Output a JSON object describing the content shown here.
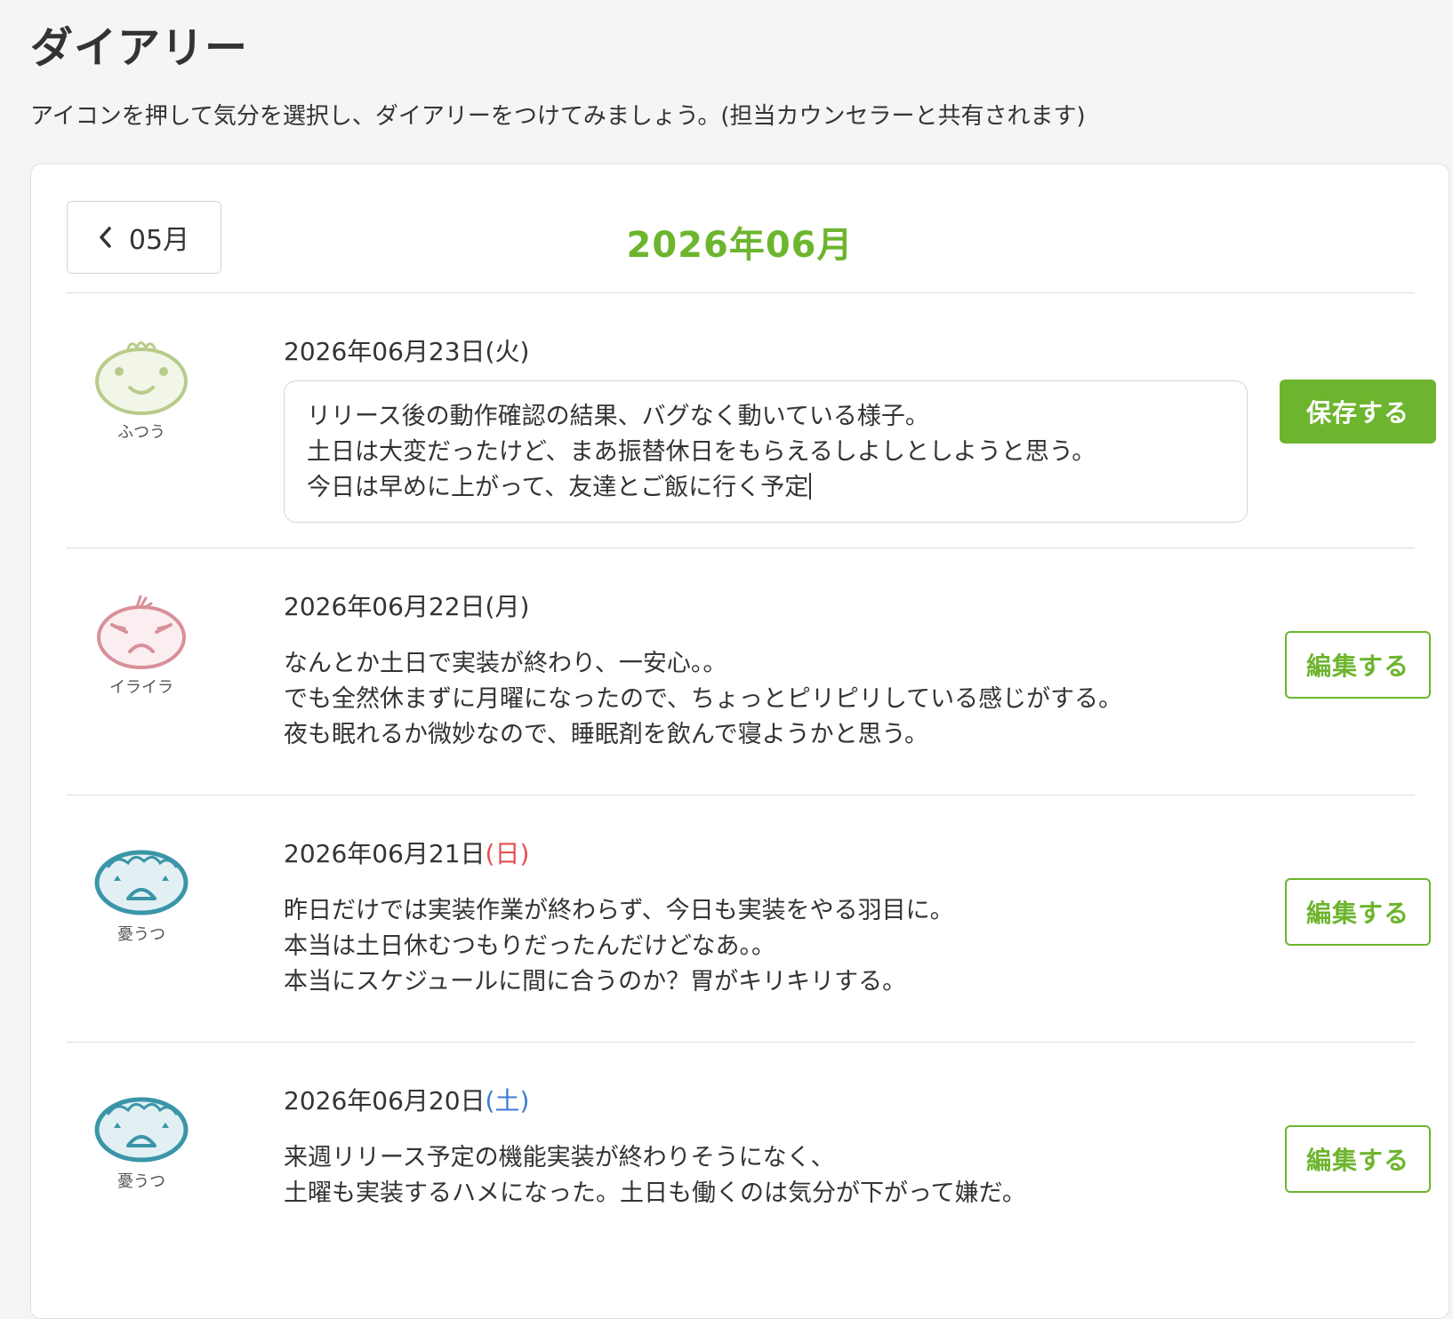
{
  "header": {
    "title": "ダイアリー",
    "description": "アイコンを押して気分を選択し、ダイアリーをつけてみましょう。(担当カウンセラーと共有されます)"
  },
  "nav": {
    "prev_month_label": "05月",
    "current_month": "2026年06月"
  },
  "colors": {
    "accent": "#6db52e",
    "sunday": "#e35050",
    "saturday": "#3a7bd5",
    "mood_normal": "#b8cc8a",
    "mood_irritated": "#d8909a",
    "mood_depressed": "#3b95a8"
  },
  "entries": [
    {
      "date": "2026年06月23日",
      "weekday": "(火)",
      "weekday_type": "weekday",
      "mood": "ふつう",
      "mood_icon": "normal-face-icon",
      "editing": true,
      "text": "リリース後の動作確認の結果、バグなく動いている様子。\n土日は大変だったけど、まあ振替休日をもらえるしよしとしようと思う。\n今日は早めに上がって、友達とご飯に行く予定",
      "action_label": "保存する"
    },
    {
      "date": "2026年06月22日",
      "weekday": "(月)",
      "weekday_type": "weekday",
      "mood": "イライラ",
      "mood_icon": "irritated-face-icon",
      "editing": false,
      "text": "なんとか土日で実装が終わり、一安心。。\nでも全然休まずに月曜になったので、ちょっとピリピリしている感じがする。\n夜も眠れるか微妙なので、睡眠剤を飲んで寝ようかと思う。",
      "action_label": "編集する"
    },
    {
      "date": "2026年06月21日",
      "weekday": "(日)",
      "weekday_type": "sunday",
      "mood": "憂うつ",
      "mood_icon": "depressed-face-icon",
      "editing": false,
      "text": "昨日だけでは実装作業が終わらず、今日も実装をやる羽目に。\n本当は土日休むつもりだったんだけどなあ。。\n本当にスケジュールに間に合うのか？胃がキリキリする。",
      "action_label": "編集する"
    },
    {
      "date": "2026年06月20日",
      "weekday": "(土)",
      "weekday_type": "saturday",
      "mood": "憂うつ",
      "mood_icon": "depressed-face-icon",
      "editing": false,
      "text": "来週リリース予定の機能実装が終わりそうになく、\n土曜も実装するハメになった。土日も働くのは気分が下がって嫌だ。",
      "action_label": "編集する"
    }
  ]
}
